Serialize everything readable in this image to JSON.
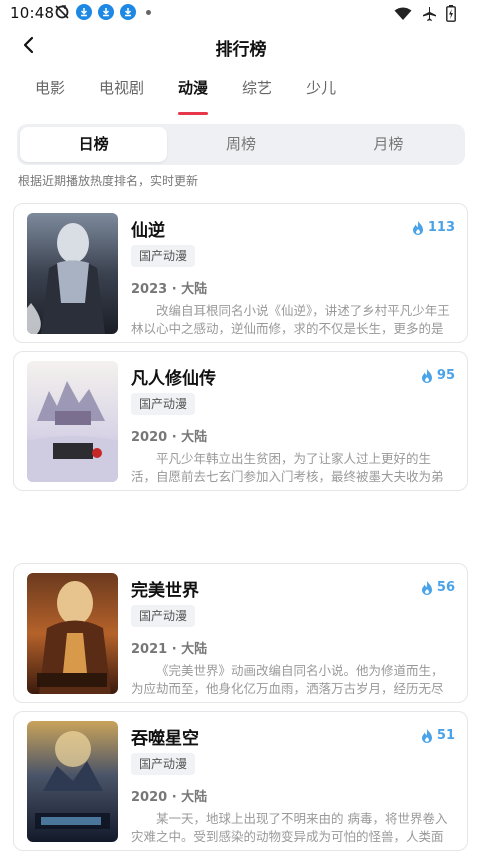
{
  "status_bar": {
    "time": "10:48"
  },
  "header": {
    "title": "排行榜"
  },
  "categories": [
    {
      "label": "电影"
    },
    {
      "label": "电视剧"
    },
    {
      "label": "动漫"
    },
    {
      "label": "综艺"
    },
    {
      "label": "少儿"
    }
  ],
  "active_category": "动漫",
  "rank_tabs": [
    {
      "label": "日榜"
    },
    {
      "label": "周榜"
    },
    {
      "label": "月榜"
    }
  ],
  "hint": "根据近期播放热度排名，实时更新",
  "colors": {
    "accent_red": "#e6374b",
    "heat_blue": "#4aa3e8"
  },
  "items": [
    {
      "title": "仙逆",
      "heat": "113",
      "tag": "国产动漫",
      "meta": "2023 · 大陆",
      "desc": "改编自耳根同名小说《仙逆》，讲述了乡村平凡少年王林以心中之感动，逆仙而修，求的不仅是长生，更多的是摆脱那屈辱的蝼蚁之身。"
    },
    {
      "title": "凡人修仙传",
      "heat": "95",
      "tag": "国产动漫",
      "meta": "2020 · 大陆",
      "desc": "平凡少年韩立出生贫困，为了让家人过上更好的生活，自愿前去七玄门参加入门考核，最终被墨大夫收为弟子。"
    },
    {
      "title": "完美世界",
      "heat": "56",
      "tag": "国产动漫",
      "meta": "2021 · 大陆",
      "desc": "《完美世界》动画改编自同名小说。他为修道而生，为应劫而至，他身化亿万血雨，洒落万古岁月，经历无尽轮回。"
    },
    {
      "title": "吞噬星空",
      "heat": "51",
      "tag": "国产动漫",
      "meta": "2020 · 大陆",
      "desc": "某一天，地球上出现了不明来由的 病毒，将世界卷入灾难之中。受到感染的动物变异成为可怕的怪兽，人类面临生存危机。"
    }
  ]
}
